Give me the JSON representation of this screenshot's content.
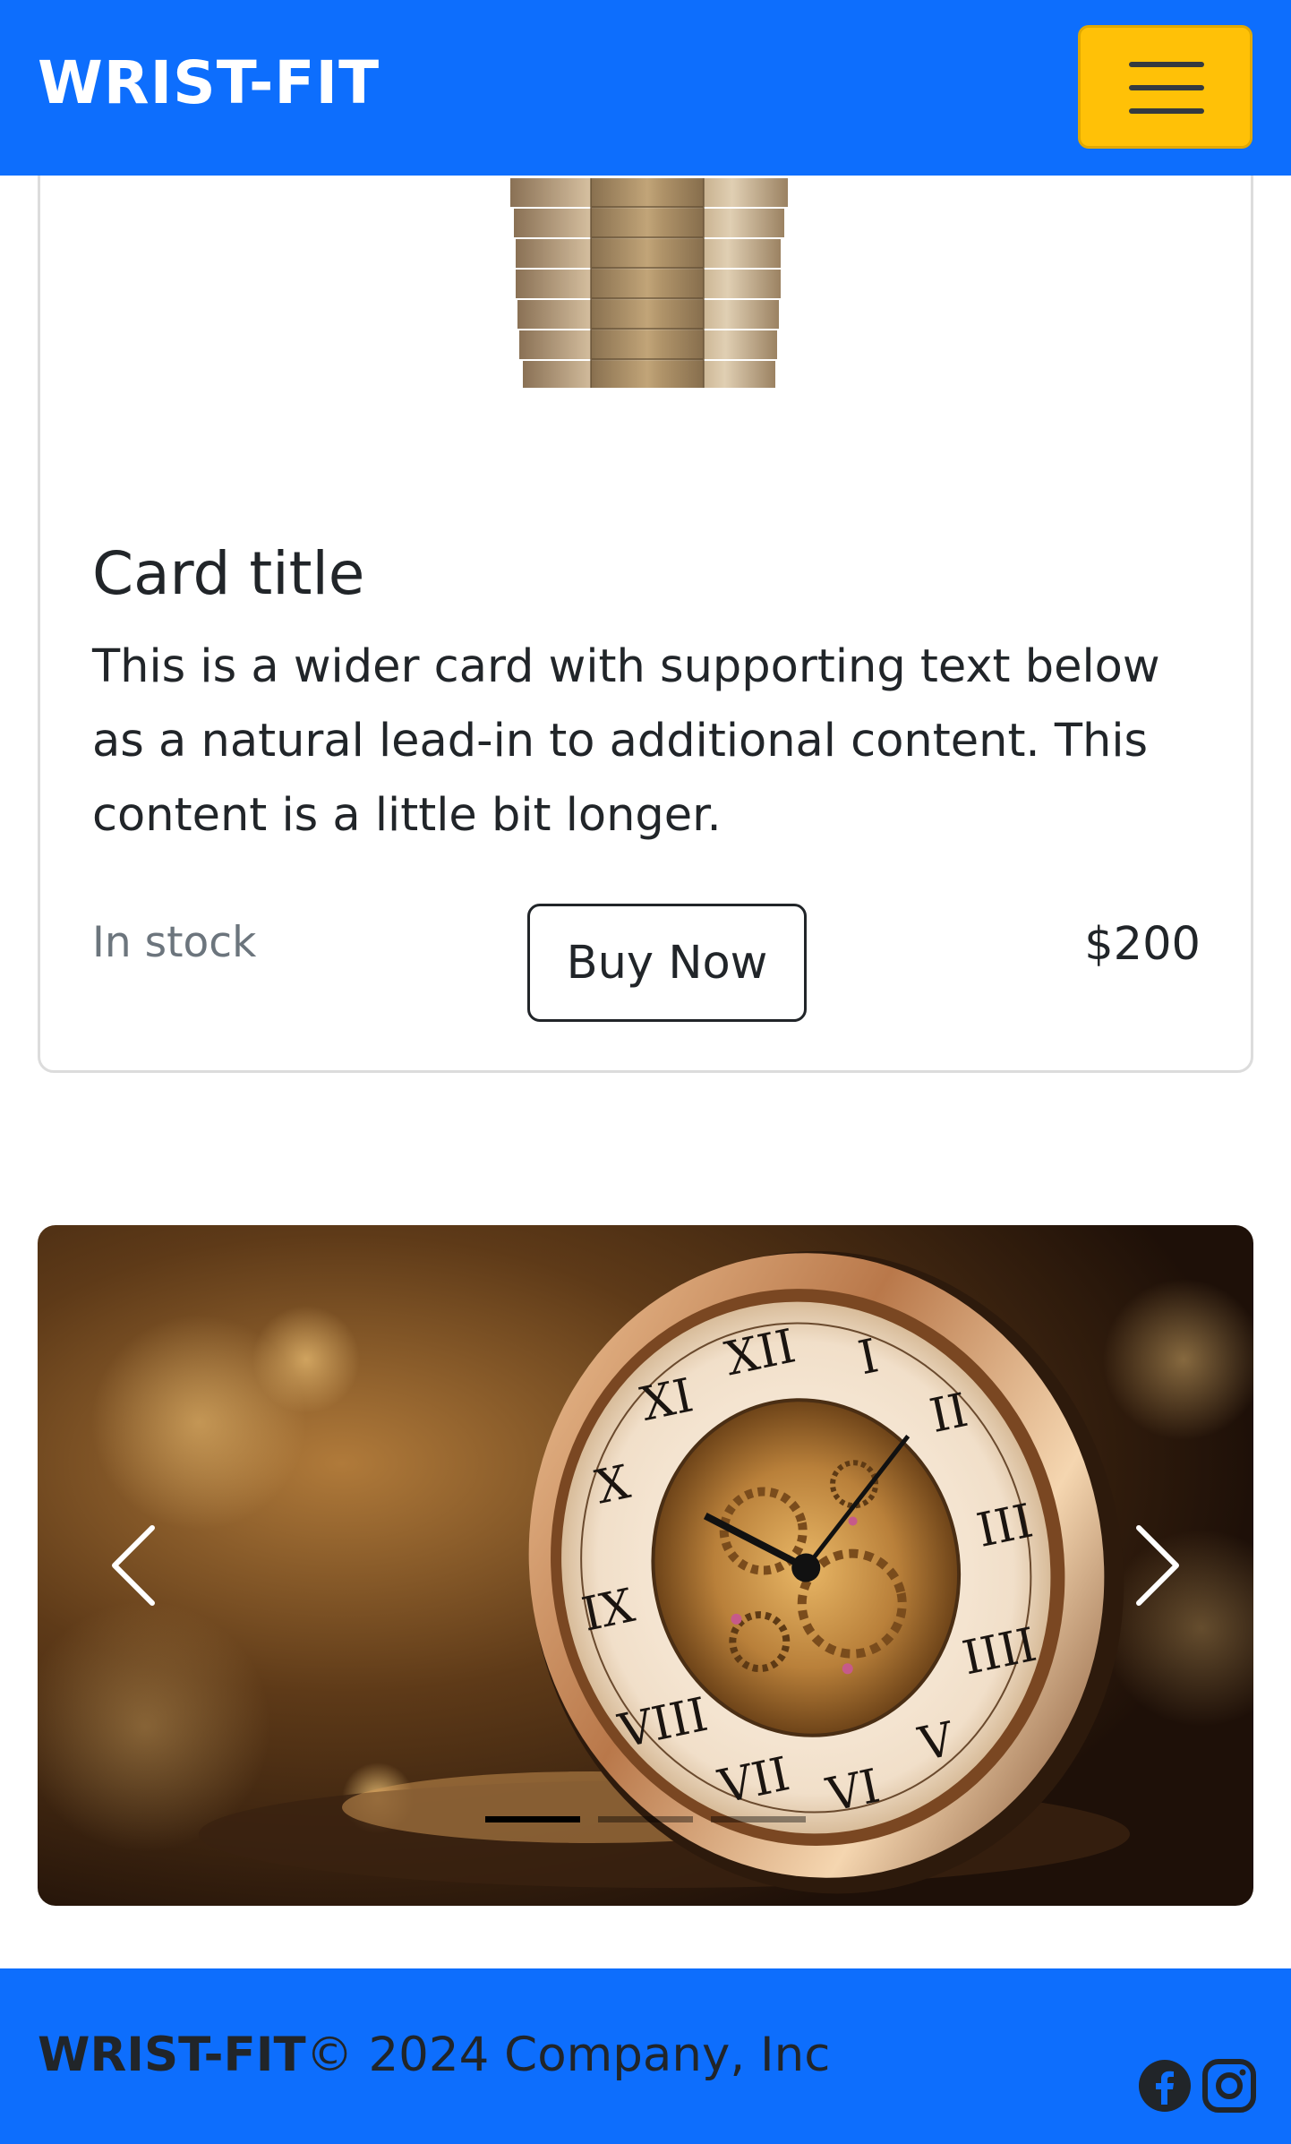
{
  "navbar": {
    "brand": "WRIST-FIT",
    "toggler_icon": "hamburger-menu-icon",
    "toggler_color": "#ffc107",
    "bg_color": "#0d6efd"
  },
  "card": {
    "title": "Card title",
    "text": "This is a wider card with supporting text below as a natural lead-in to additional content. This content is a little bit longer.",
    "stock": "In stock",
    "button_label": "Buy Now",
    "price": "$200"
  },
  "carousel": {
    "prev_icon": "chevron-left-icon",
    "next_icon": "chevron-right-icon",
    "slides": 3,
    "active_index": 0
  },
  "footer": {
    "brand": "WRIST-FIT",
    "copyright": "© 2024 Company, Inc",
    "social_icons": [
      "facebook-icon",
      "instagram-icon"
    ]
  }
}
